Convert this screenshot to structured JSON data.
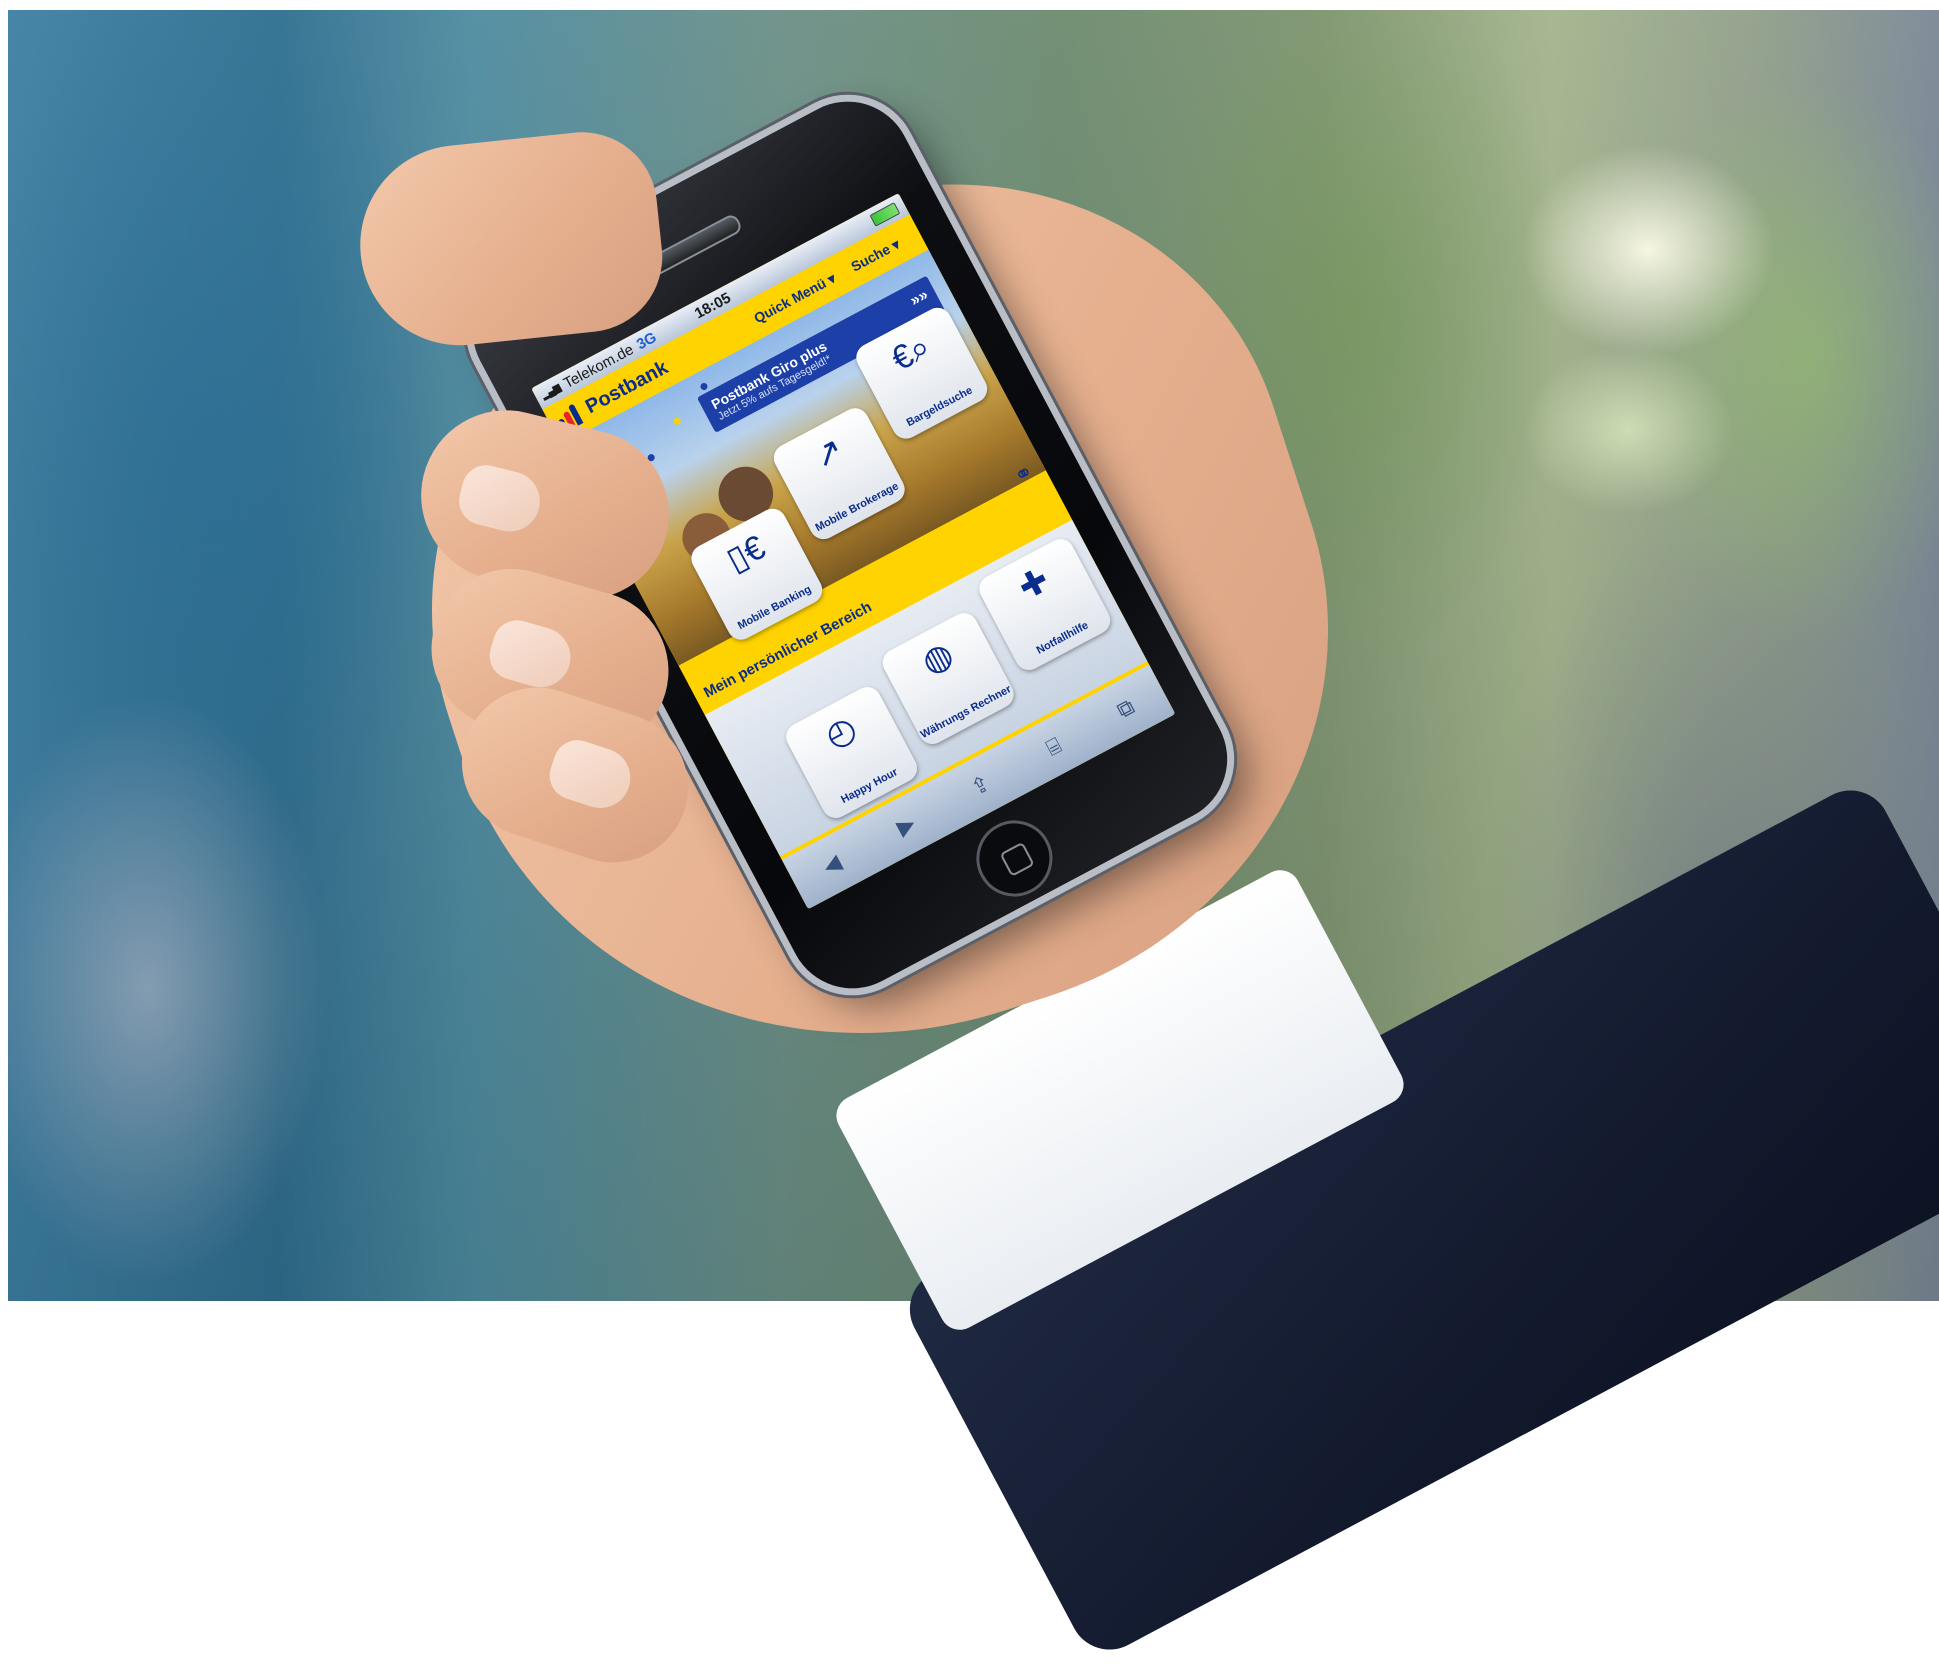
{
  "status_bar": {
    "carrier": "Telekom.de",
    "network": "3G",
    "time": "18:05"
  },
  "header": {
    "brand": "Postbank",
    "quick_menu": "Quick Menü ▾",
    "search": "Suche ▾"
  },
  "promo": {
    "title": "Postbank Giro plus",
    "subtitle": "Jetzt 5% aufs Tagesgeld!*",
    "arrows": "»»"
  },
  "tiles": [
    {
      "label": "Bargeldsuche",
      "icon": "euro-magnifier-icon",
      "glyph": "€⌕"
    },
    {
      "label": "Mobile Brokerage",
      "icon": "chart-arrow-icon",
      "glyph": "↗"
    },
    {
      "label": "Mobile Banking",
      "icon": "phone-euro-icon",
      "glyph": "▯€"
    },
    {
      "label": "Notfallhilfe",
      "icon": "cross-icon",
      "glyph": "✚"
    },
    {
      "label": "Währungs Rechner",
      "icon": "globe-icon",
      "glyph": "◍"
    },
    {
      "label": "Happy Hour",
      "icon": "clock-icon",
      "glyph": "◴"
    }
  ],
  "section": {
    "title": "Mein persönlicher Bereich"
  },
  "toolbar": {
    "back": "◀",
    "forward": "▶",
    "share": "⇪",
    "bookmarks": "⌸",
    "tabs": "⧉"
  },
  "colors": {
    "brand_yellow": "#ffd300",
    "brand_blue": "#0a2c8c"
  }
}
